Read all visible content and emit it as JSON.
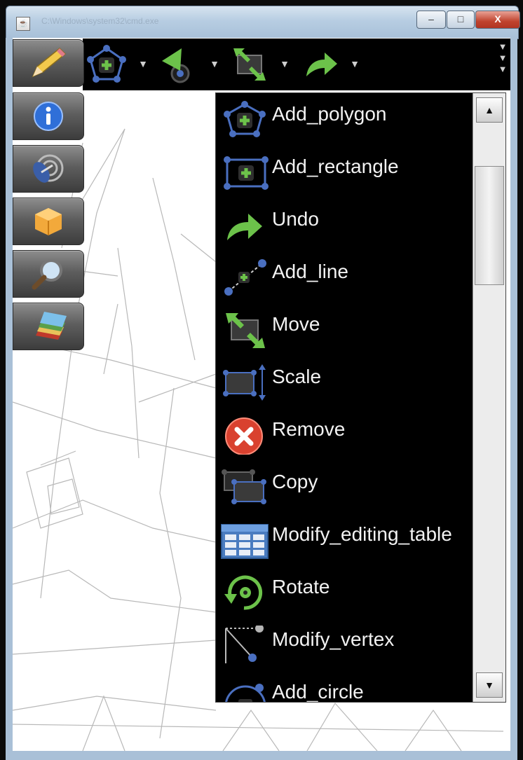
{
  "window": {
    "title": "C:\\Windows\\system32\\cmd.exe",
    "app_icon": "java-cup-icon",
    "minimize_label": "–",
    "maximize_label": "□",
    "close_label": "X"
  },
  "toolbar": {
    "tools": [
      {
        "name": "add-polygon-tool",
        "icon": "polygon-add-icon"
      },
      {
        "name": "select-tool",
        "icon": "select-arrow-icon"
      },
      {
        "name": "move-tool",
        "icon": "move-icon"
      },
      {
        "name": "undo-tool",
        "icon": "undo-icon"
      }
    ],
    "dropdown_arrow": "▼",
    "overflow_arrows": [
      "▼",
      "▼",
      "▼"
    ]
  },
  "sidebar": {
    "buttons": [
      {
        "name": "edit",
        "icon": "pencil-icon"
      },
      {
        "name": "info",
        "icon": "info-icon"
      },
      {
        "name": "radar",
        "icon": "radar-icon"
      },
      {
        "name": "package",
        "icon": "box-icon"
      },
      {
        "name": "search",
        "icon": "magnifier-icon"
      },
      {
        "name": "layers",
        "icon": "layers-icon"
      }
    ]
  },
  "menu": {
    "items": [
      {
        "label": "Add_polygon",
        "icon": "add-polygon-icon"
      },
      {
        "label": "Add_rectangle",
        "icon": "add-rectangle-icon"
      },
      {
        "label": "Undo",
        "icon": "undo-icon"
      },
      {
        "label": "Add_line",
        "icon": "add-line-icon"
      },
      {
        "label": "Move",
        "icon": "move-icon"
      },
      {
        "label": "Scale",
        "icon": "scale-icon"
      },
      {
        "label": "Remove",
        "icon": "remove-icon"
      },
      {
        "label": "Copy",
        "icon": "copy-icon"
      },
      {
        "label": "Modify_editing_table",
        "icon": "table-icon"
      },
      {
        "label": "Rotate",
        "icon": "rotate-icon"
      },
      {
        "label": "Modify_vertex",
        "icon": "vertex-icon"
      },
      {
        "label": "Add_circle",
        "icon": "add-circle-icon"
      }
    ],
    "scroll_up": "▲",
    "scroll_down": "▼"
  },
  "colors": {
    "accent_green": "#6cc24a",
    "node_blue": "#4a6fc0",
    "remove_red": "#d9412f"
  }
}
